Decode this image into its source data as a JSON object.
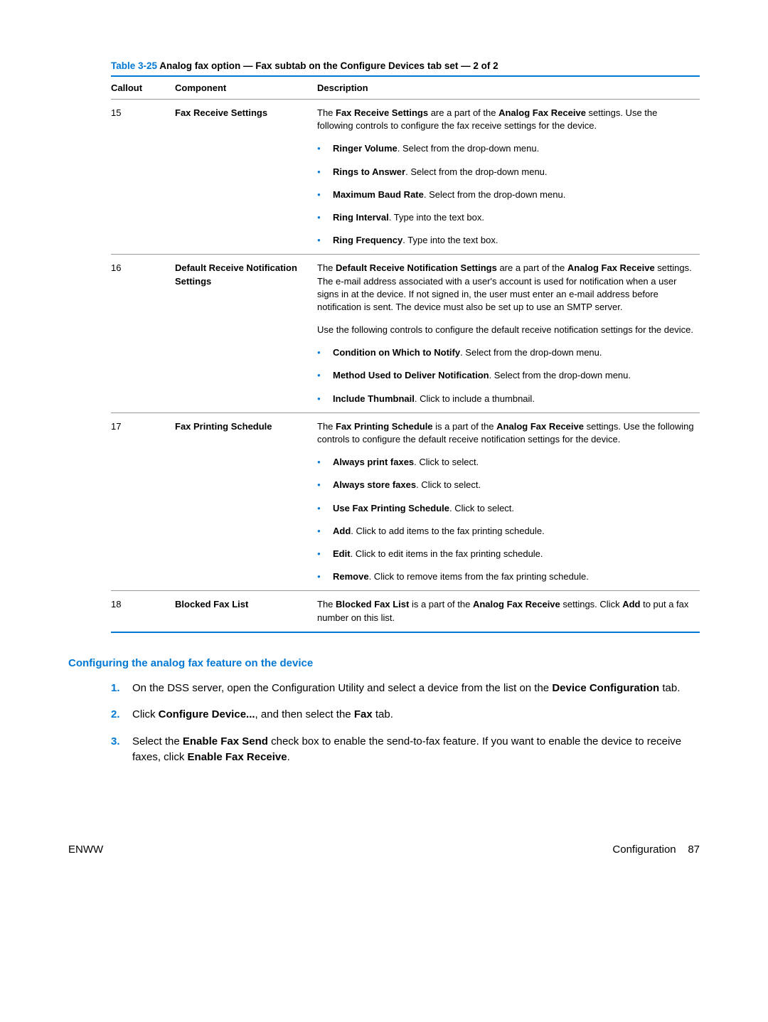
{
  "table": {
    "caption_num": "Table 3-25",
    "caption_title": "  Analog fax option — Fax subtab on the Configure Devices tab set — 2 of 2",
    "headers": {
      "callout": "Callout",
      "component": "Component",
      "description": "Description"
    },
    "rows": [
      {
        "callout": "15",
        "component": "Fax Receive Settings",
        "desc_intro_pre": "The ",
        "desc_intro_b1": "Fax Receive Settings",
        "desc_intro_mid": " are a part of the ",
        "desc_intro_b2": "Analog Fax Receive",
        "desc_intro_post": " settings. Use the following controls to configure the fax receive settings for the device.",
        "bullets": [
          {
            "label": "Ringer Volume",
            "text": ". Select from the drop-down menu."
          },
          {
            "label": "Rings to Answer",
            "text": ". Select from the drop-down menu."
          },
          {
            "label": "Maximum Baud Rate",
            "text": ". Select from the drop-down menu."
          },
          {
            "label": "Ring Interval",
            "text": ". Type into the text box."
          },
          {
            "label": "Ring Frequency",
            "text": ". Type into the text box."
          }
        ]
      },
      {
        "callout": "16",
        "component": "Default Receive Notification Settings",
        "desc_intro_pre": "The ",
        "desc_intro_b1": "Default Receive Notification Settings",
        "desc_intro_mid": " are a part of the ",
        "desc_intro_b2": "Analog Fax Receive",
        "desc_intro_post": " settings. The e-mail address associated with a user's account is used for notification when a user signs in at the device. If not signed in, the user must enter an e-mail address before notification is sent. The device must also be set up to use an SMTP server.",
        "desc_para2": "Use the following controls to configure the default receive notification settings for the device.",
        "bullets": [
          {
            "label": "Condition on Which to Notify",
            "text": ". Select from the drop-down menu."
          },
          {
            "label": "Method Used to Deliver Notification",
            "text": ". Select from the drop-down menu."
          },
          {
            "label": "Include Thumbnail",
            "text": ". Click to include a thumbnail."
          }
        ]
      },
      {
        "callout": "17",
        "component": "Fax Printing Schedule",
        "desc_intro_pre": "The ",
        "desc_intro_b1": "Fax Printing Schedule",
        "desc_intro_mid": " is a part of the ",
        "desc_intro_b2": "Analog Fax Receive",
        "desc_intro_post": " settings. Use the following controls to configure the default receive notification settings for the device.",
        "bullets": [
          {
            "label": "Always print faxes",
            "text": ". Click to select."
          },
          {
            "label": "Always store faxes",
            "text": ". Click to select."
          },
          {
            "label": "Use Fax Printing Schedule",
            "text": ". Click to select."
          },
          {
            "label": "Add",
            "text": ". Click to add items to the fax printing schedule."
          },
          {
            "label": "Edit",
            "text": ". Click to edit items in the fax printing schedule."
          },
          {
            "label": "Remove",
            "text": ". Click to remove items from the fax printing schedule."
          }
        ]
      },
      {
        "callout": "18",
        "component": "Blocked Fax List",
        "desc_intro_pre": "The ",
        "desc_intro_b1": "Blocked Fax List",
        "desc_intro_mid": " is a part of the ",
        "desc_intro_b2": "Analog Fax Receive",
        "desc_intro_post": " settings. Click ",
        "desc_intro_b3": "Add",
        "desc_intro_post2": " to put a fax number on this list."
      }
    ]
  },
  "section": {
    "heading": "Configuring the analog fax feature on the device",
    "steps": [
      {
        "num": "1.",
        "pre": "On the DSS server, open the Configuration Utility and select a device from the list on the ",
        "b1": "Device Configuration",
        "post": " tab."
      },
      {
        "num": "2.",
        "pre": "Click ",
        "b1": "Configure Device...",
        "mid": ", and then select the ",
        "b2": "Fax",
        "post": " tab."
      },
      {
        "num": "3.",
        "pre": "Select the ",
        "b1": "Enable Fax Send",
        "mid": " check box to enable the send-to-fax feature. If you want to enable the device to receive faxes, click ",
        "b2": "Enable Fax Receive",
        "post": "."
      }
    ]
  },
  "footer": {
    "left": "ENWW",
    "right_label": "Configuration",
    "right_page": "87"
  }
}
